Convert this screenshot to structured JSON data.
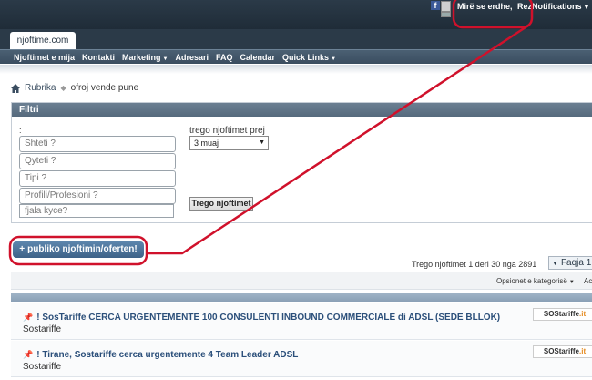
{
  "topbar": {
    "facebook_icon": "facebook-icon",
    "facebook_glyph": "f",
    "greeting": "Mirë se erdhe,",
    "username": "Rezi",
    "notifications_label": "Notifications"
  },
  "site": {
    "tab_label": "njoftime.com"
  },
  "nav": {
    "items": [
      {
        "label": "Njoftimet e mija",
        "has_caret": false
      },
      {
        "label": "Kontakti",
        "has_caret": false
      },
      {
        "label": "Marketing",
        "has_caret": true
      },
      {
        "label": "Adresari",
        "has_caret": false
      },
      {
        "label": "FAQ",
        "has_caret": false
      },
      {
        "label": "Calendar",
        "has_caret": false
      },
      {
        "label": "Quick Links",
        "has_caret": true
      }
    ]
  },
  "breadcrumb": {
    "home_icon": "home-icon",
    "root": "Rubrika",
    "current": "ofroj vende pune"
  },
  "filter": {
    "heading": "Filtri",
    "colon": ":",
    "region_placeholder": "Shteti ?",
    "city_placeholder": "Qyteti ?",
    "type_placeholder": "Tipi ?",
    "profile_placeholder": "Profili/Profesioni ?",
    "keyword_placeholder": "fjala kyce?",
    "period_label": "trego njoftimet prej",
    "period_value": "3 muaj",
    "show_button": "Trego njoftimet"
  },
  "publish_button": {
    "plus": "+",
    "label": "publiko njoftimin/oferten!"
  },
  "listing": {
    "count_text": "Trego njoftimet 1 deri 30 nga 2891",
    "page_label": "Faqja 1",
    "sort_label": "Opsionet e kategorisë",
    "sort_col": "Ac",
    "rows": [
      {
        "title": "! SosTariffe CERCA URGENTEMENTE 100 CONSULENTI INBOUND COMMERCIALE di ADSL (SEDE BLLOK)",
        "author": "Sostariffe",
        "logo_main": "SOStariffe",
        "logo_suffix": ".it"
      },
      {
        "title": "! Tirane, Sostariffe cerca urgentemente 4 Team Leader ADSL",
        "author": "Sostariffe",
        "logo_main": "SOStariffe",
        "logo_suffix": ".it"
      }
    ]
  },
  "colors": {
    "topbar": "#2b3a48",
    "nav": "#3a4d60",
    "accent_link": "#2b4f7a",
    "publish": "#4a729a",
    "annotation": "#d0112b"
  }
}
